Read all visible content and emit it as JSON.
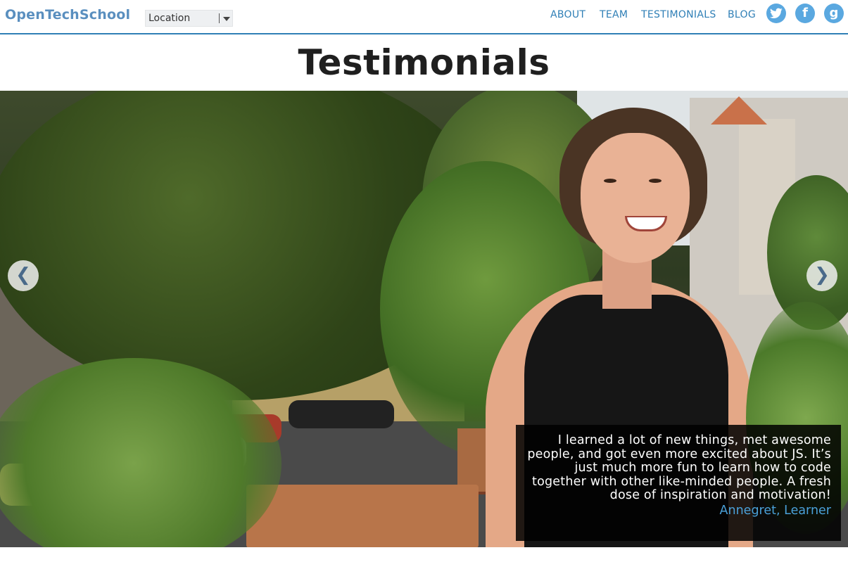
{
  "header": {
    "logo": "OpenTechSchool",
    "location_label": "Location",
    "nav": [
      {
        "label": "ABOUT"
      },
      {
        "label": "TEAM"
      },
      {
        "label": "TESTIMONIALS"
      },
      {
        "label": "BLOG"
      }
    ],
    "social": [
      {
        "icon": "twitter-icon"
      },
      {
        "icon": "facebook-icon",
        "glyph": "f"
      },
      {
        "icon": "google-plus-icon",
        "glyph": "g"
      }
    ]
  },
  "page": {
    "title": "Testimonials"
  },
  "carousel": {
    "prev_glyph": "❮",
    "next_glyph": "❯",
    "quote": "I learned a lot of new things, met awesome people, and got even more excited about JS. It’s just much more fun to learn how to code together with other like-minded people. A fresh dose of inspiration and motivation!",
    "author": "Annegret, Learner"
  },
  "colors": {
    "brand": "#2f7fb6",
    "logo": "#5a8fbf",
    "social": "#5aa8e0",
    "author": "#4aa0d8"
  }
}
